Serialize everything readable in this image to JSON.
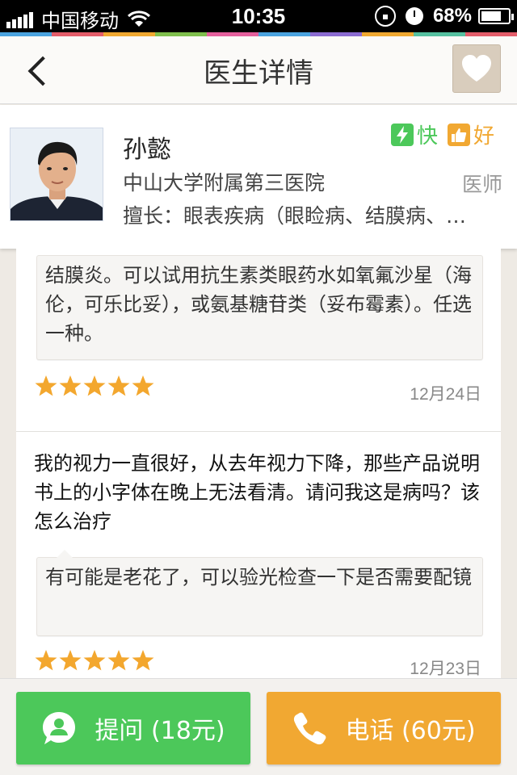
{
  "status_bar": {
    "carrier": "中国移动",
    "time": "10:35",
    "battery": "68%"
  },
  "stripe_colors": [
    "#4aa3df",
    "#e35d6a",
    "#f0a830",
    "#7fbf4d",
    "#e45f9d",
    "#4aa3df",
    "#8b6bd1",
    "#f0a830",
    "#55c0a0",
    "#e35d6a"
  ],
  "nav": {
    "title": "医生详情"
  },
  "doctor": {
    "name": "孙懿",
    "hospital": "中山大学附属第三医院",
    "title": "医师",
    "specialty": "擅长：眼表疾病（眼睑病、结膜病、…",
    "badges": [
      {
        "label": "快",
        "color": "#4cc85a",
        "icon": "lightning-icon"
      },
      {
        "label": "好",
        "color": "#f1a832",
        "icon": "thumbs-up-icon"
      }
    ]
  },
  "reviews": [
    {
      "question": "",
      "answer": "结膜炎。可以试用抗生素类眼药水如氧氟沙星（海伦，可乐比妥），或氨基糖苷类（妥布霉素）。任选一种。",
      "rating": 5,
      "date": "12月24日"
    },
    {
      "question": "我的视力一直很好，从去年视力下降，那些产品说明书上的小字体在晚上无法看清。请问我这是病吗？该怎么治疗",
      "answer": "有可能是老花了，可以验光检查一下是否需要配镜",
      "rating": 5,
      "date": "12月23日"
    }
  ],
  "actions": {
    "ask_label": "提问 (18元)",
    "call_label": "电话 (60元)"
  },
  "colors": {
    "green": "#4cc85a",
    "orange": "#f1a832",
    "star": "#f3a72e"
  }
}
